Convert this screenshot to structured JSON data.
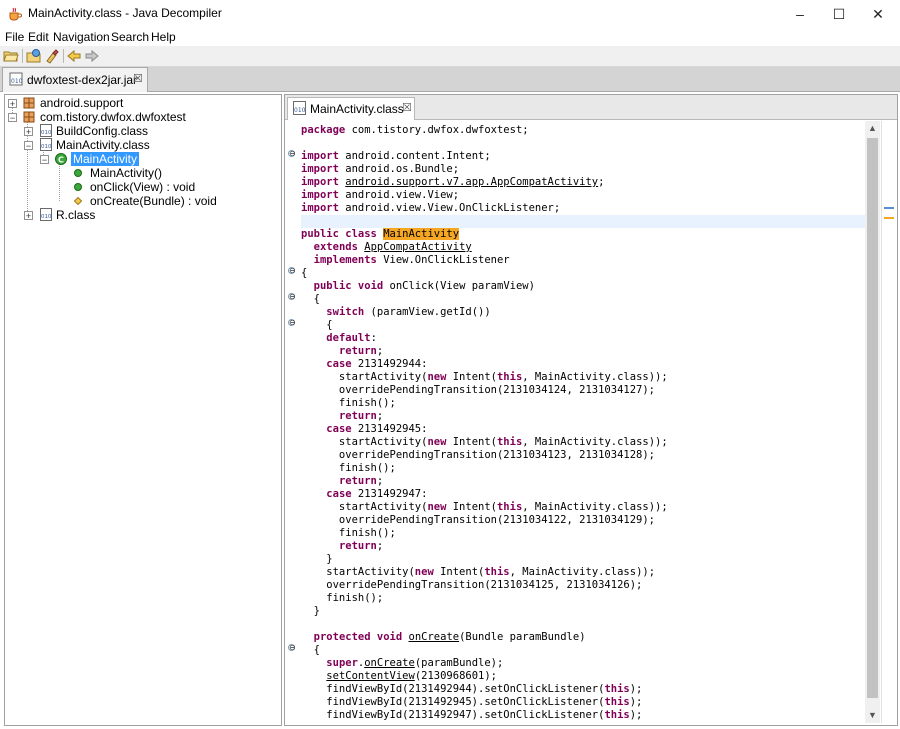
{
  "window": {
    "title": "MainActivity.class - Java Decompiler",
    "minimize": "–",
    "maximize": "☐",
    "close": "✕"
  },
  "menu": [
    "File",
    "Edit",
    "Navigation",
    "Search",
    "Help"
  ],
  "toolbar": {
    "buttons": [
      "open-file-icon",
      "open-type-icon",
      "search-icon",
      "back-icon",
      "forward-icon"
    ]
  },
  "file_tab": {
    "label": "dwfoxtest-dex2jar.jar",
    "close": "☒"
  },
  "tree": {
    "packages": [
      {
        "label": "android.support",
        "expanded": false
      },
      {
        "label": "com.tistory.dwfox.dwfoxtest",
        "expanded": true
      }
    ],
    "classes": [
      "BuildConfig.class",
      "MainActivity.class",
      "R.class"
    ],
    "selected_class": "MainActivity",
    "members": [
      "MainActivity()",
      "onClick(View) : void",
      "onCreate(Bundle) : void"
    ]
  },
  "editor_tab": {
    "label": "MainActivity.class",
    "close": "☒"
  },
  "code_lines": [
    "package com.tistory.dwfox.dwfoxtest;",
    "",
    "import android.content.Intent;",
    "import android.os.Bundle;",
    "import android.support.v7.app.AppCompatActivity;",
    "import android.view.View;",
    "import android.view.View.OnClickListener;",
    "",
    "public class MainActivity",
    "  extends AppCompatActivity",
    "  implements View.OnClickListener",
    "{",
    "  public void onClick(View paramView)",
    "  {",
    "    switch (paramView.getId())",
    "    {",
    "    default:",
    "      return;",
    "    case 2131492944:",
    "      startActivity(new Intent(this, MainActivity.class));",
    "      overridePendingTransition(2131034124, 2131034127);",
    "      finish();",
    "      return;",
    "    case 2131492945:",
    "      startActivity(new Intent(this, MainActivity.class));",
    "      overridePendingTransition(2131034123, 2131034128);",
    "      finish();",
    "      return;",
    "    case 2131492947:",
    "      startActivity(new Intent(this, MainActivity.class));",
    "      overridePendingTransition(2131034122, 2131034129);",
    "      finish();",
    "      return;",
    "    }",
    "    startActivity(new Intent(this, MainActivity.class));",
    "    overridePendingTransition(2131034125, 2131034126);",
    "    finish();",
    "  }",
    "",
    "  protected void onCreate(Bundle paramBundle)",
    "  {",
    "    super.onCreate(paramBundle);",
    "    setContentView(2130968601);",
    "    findViewById(2131492944).setOnClickListener(this);",
    "    findViewById(2131492945).setOnClickListener(this);",
    "    findViewById(2131492947).setOnClickListener(this);"
  ],
  "fold_markers": [
    "⊖",
    "⊖",
    "⊖",
    "⊖",
    "⊖",
    "⊖"
  ],
  "colors": {
    "keyword": "#7f0055",
    "selection": "#3399ff",
    "search_hit": "#f5a623",
    "current_line": "#e8f2fe"
  }
}
